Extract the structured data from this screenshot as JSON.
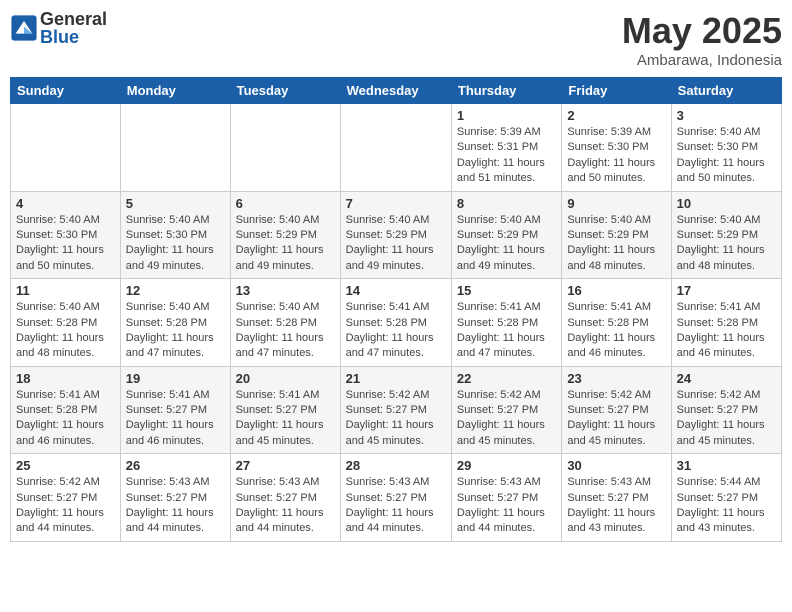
{
  "header": {
    "logo_general": "General",
    "logo_blue": "Blue",
    "month": "May 2025",
    "location": "Ambarawa, Indonesia"
  },
  "weekdays": [
    "Sunday",
    "Monday",
    "Tuesday",
    "Wednesday",
    "Thursday",
    "Friday",
    "Saturday"
  ],
  "weeks": [
    [
      {
        "day": "",
        "info": ""
      },
      {
        "day": "",
        "info": ""
      },
      {
        "day": "",
        "info": ""
      },
      {
        "day": "",
        "info": ""
      },
      {
        "day": "1",
        "info": "Sunrise: 5:39 AM\nSunset: 5:31 PM\nDaylight: 11 hours and 51 minutes."
      },
      {
        "day": "2",
        "info": "Sunrise: 5:39 AM\nSunset: 5:30 PM\nDaylight: 11 hours and 50 minutes."
      },
      {
        "day": "3",
        "info": "Sunrise: 5:40 AM\nSunset: 5:30 PM\nDaylight: 11 hours and 50 minutes."
      }
    ],
    [
      {
        "day": "4",
        "info": "Sunrise: 5:40 AM\nSunset: 5:30 PM\nDaylight: 11 hours and 50 minutes."
      },
      {
        "day": "5",
        "info": "Sunrise: 5:40 AM\nSunset: 5:30 PM\nDaylight: 11 hours and 49 minutes."
      },
      {
        "day": "6",
        "info": "Sunrise: 5:40 AM\nSunset: 5:29 PM\nDaylight: 11 hours and 49 minutes."
      },
      {
        "day": "7",
        "info": "Sunrise: 5:40 AM\nSunset: 5:29 PM\nDaylight: 11 hours and 49 minutes."
      },
      {
        "day": "8",
        "info": "Sunrise: 5:40 AM\nSunset: 5:29 PM\nDaylight: 11 hours and 49 minutes."
      },
      {
        "day": "9",
        "info": "Sunrise: 5:40 AM\nSunset: 5:29 PM\nDaylight: 11 hours and 48 minutes."
      },
      {
        "day": "10",
        "info": "Sunrise: 5:40 AM\nSunset: 5:29 PM\nDaylight: 11 hours and 48 minutes."
      }
    ],
    [
      {
        "day": "11",
        "info": "Sunrise: 5:40 AM\nSunset: 5:28 PM\nDaylight: 11 hours and 48 minutes."
      },
      {
        "day": "12",
        "info": "Sunrise: 5:40 AM\nSunset: 5:28 PM\nDaylight: 11 hours and 47 minutes."
      },
      {
        "day": "13",
        "info": "Sunrise: 5:40 AM\nSunset: 5:28 PM\nDaylight: 11 hours and 47 minutes."
      },
      {
        "day": "14",
        "info": "Sunrise: 5:41 AM\nSunset: 5:28 PM\nDaylight: 11 hours and 47 minutes."
      },
      {
        "day": "15",
        "info": "Sunrise: 5:41 AM\nSunset: 5:28 PM\nDaylight: 11 hours and 47 minutes."
      },
      {
        "day": "16",
        "info": "Sunrise: 5:41 AM\nSunset: 5:28 PM\nDaylight: 11 hours and 46 minutes."
      },
      {
        "day": "17",
        "info": "Sunrise: 5:41 AM\nSunset: 5:28 PM\nDaylight: 11 hours and 46 minutes."
      }
    ],
    [
      {
        "day": "18",
        "info": "Sunrise: 5:41 AM\nSunset: 5:28 PM\nDaylight: 11 hours and 46 minutes."
      },
      {
        "day": "19",
        "info": "Sunrise: 5:41 AM\nSunset: 5:27 PM\nDaylight: 11 hours and 46 minutes."
      },
      {
        "day": "20",
        "info": "Sunrise: 5:41 AM\nSunset: 5:27 PM\nDaylight: 11 hours and 45 minutes."
      },
      {
        "day": "21",
        "info": "Sunrise: 5:42 AM\nSunset: 5:27 PM\nDaylight: 11 hours and 45 minutes."
      },
      {
        "day": "22",
        "info": "Sunrise: 5:42 AM\nSunset: 5:27 PM\nDaylight: 11 hours and 45 minutes."
      },
      {
        "day": "23",
        "info": "Sunrise: 5:42 AM\nSunset: 5:27 PM\nDaylight: 11 hours and 45 minutes."
      },
      {
        "day": "24",
        "info": "Sunrise: 5:42 AM\nSunset: 5:27 PM\nDaylight: 11 hours and 45 minutes."
      }
    ],
    [
      {
        "day": "25",
        "info": "Sunrise: 5:42 AM\nSunset: 5:27 PM\nDaylight: 11 hours and 44 minutes."
      },
      {
        "day": "26",
        "info": "Sunrise: 5:43 AM\nSunset: 5:27 PM\nDaylight: 11 hours and 44 minutes."
      },
      {
        "day": "27",
        "info": "Sunrise: 5:43 AM\nSunset: 5:27 PM\nDaylight: 11 hours and 44 minutes."
      },
      {
        "day": "28",
        "info": "Sunrise: 5:43 AM\nSunset: 5:27 PM\nDaylight: 11 hours and 44 minutes."
      },
      {
        "day": "29",
        "info": "Sunrise: 5:43 AM\nSunset: 5:27 PM\nDaylight: 11 hours and 44 minutes."
      },
      {
        "day": "30",
        "info": "Sunrise: 5:43 AM\nSunset: 5:27 PM\nDaylight: 11 hours and 43 minutes."
      },
      {
        "day": "31",
        "info": "Sunrise: 5:44 AM\nSunset: 5:27 PM\nDaylight: 11 hours and 43 minutes."
      }
    ]
  ]
}
